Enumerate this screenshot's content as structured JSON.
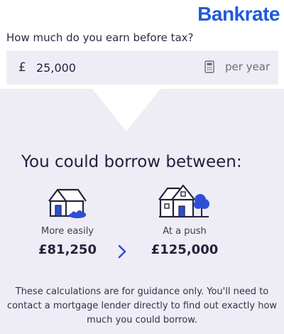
{
  "brand": {
    "logo_text": "Bankrate",
    "accent": "#1e5bd8"
  },
  "income": {
    "question": "How much do you earn before tax?",
    "currency_symbol": "£",
    "value": "25,000",
    "period": "per year",
    "icon": "calculator-icon"
  },
  "result": {
    "headline": "You could borrow between:",
    "easy": {
      "label": "More easily",
      "value": "£81,250",
      "icon": "house-icon"
    },
    "push": {
      "label": "At a push",
      "value": "£125,000",
      "icon": "house-with-tree-icon"
    },
    "arrow_icon": "chevron-right-icon"
  },
  "disclaimer": "These calculations are for guidance only. You'll need to contact a mortgage lender directly to find out exactly how much you could borrow.",
  "colors": {
    "panel": "#eeedf5",
    "house_blue": "#2d4fd6",
    "text": "#23233c"
  }
}
